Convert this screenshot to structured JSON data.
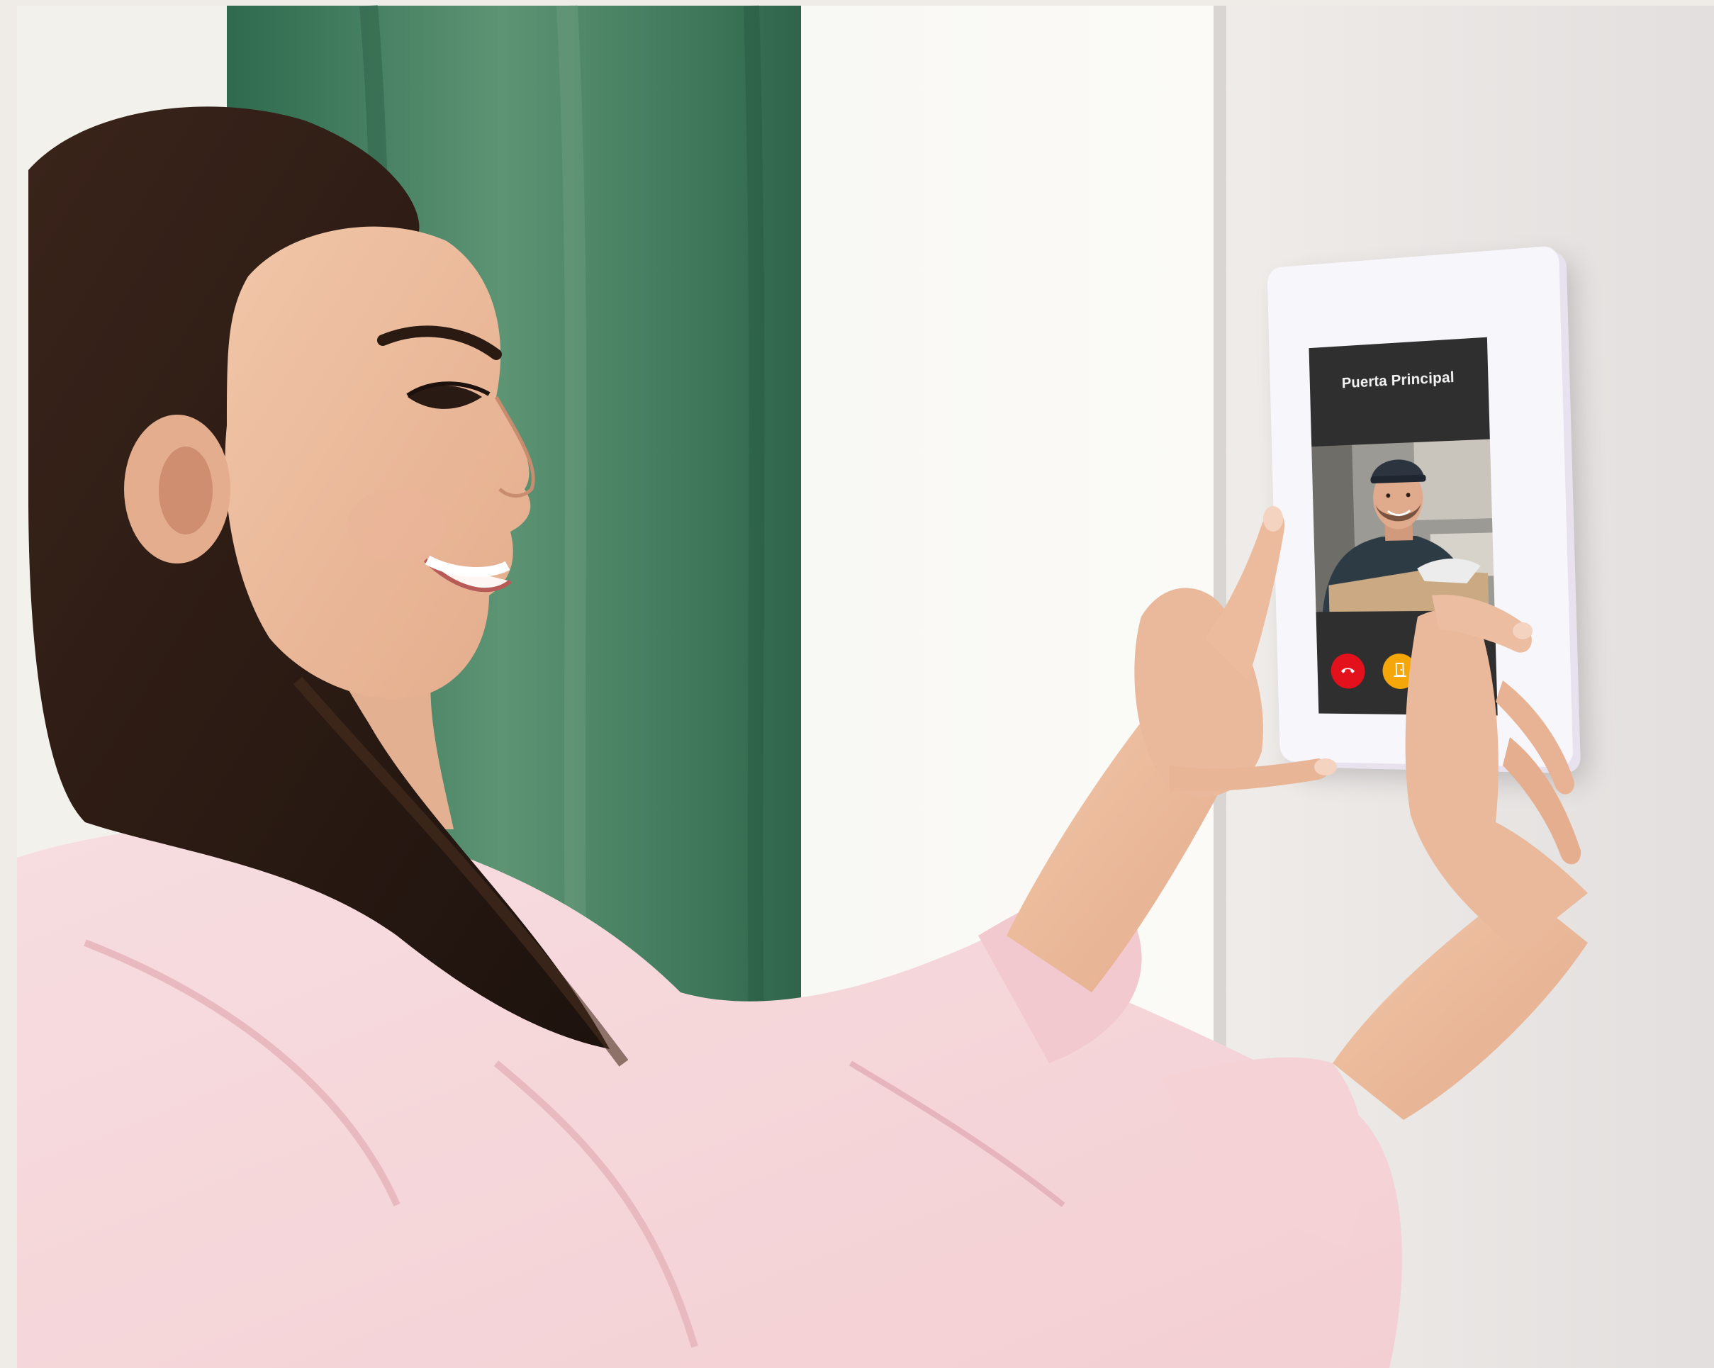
{
  "intercom": {
    "screen_title": "Puerta Principal",
    "hangup_icon": "hang-up-phone-icon",
    "door_icon": "door-open-icon"
  },
  "colors": {
    "hangup": "#e3111c",
    "door": "#f5a609",
    "screen_bg": "#2f2f2f",
    "curtain": "#3f7a5c",
    "shirt": "#f6d7d8"
  }
}
